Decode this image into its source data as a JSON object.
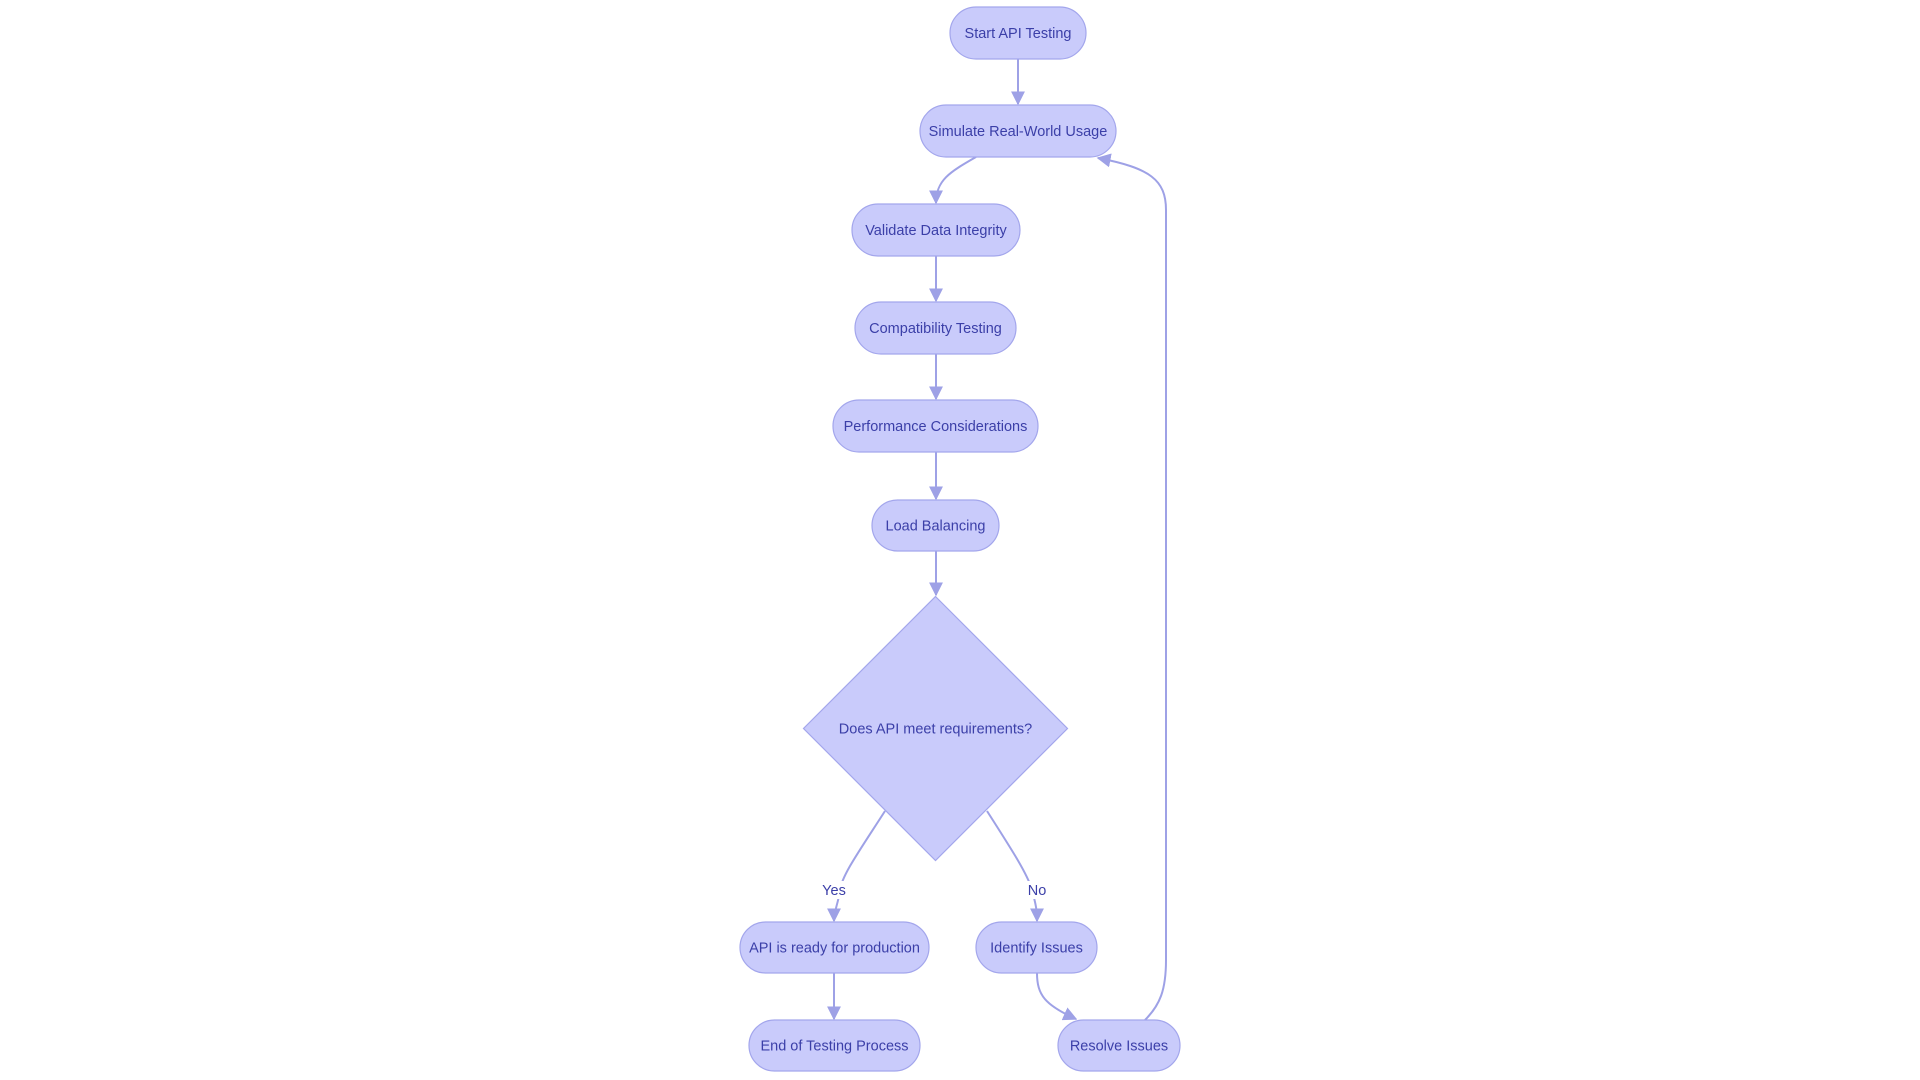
{
  "diagram": {
    "type": "flowchart",
    "colors": {
      "node_fill": "#c9cbfb",
      "node_stroke": "#a3a6ec",
      "edge": "#9ea1e6",
      "text": "#3b3fa8"
    },
    "nodes": [
      {
        "id": "start",
        "label": "Start API Testing",
        "shape": "stadium"
      },
      {
        "id": "simulate",
        "label": "Simulate Real-World Usage",
        "shape": "stadium"
      },
      {
        "id": "validate",
        "label": "Validate Data Integrity",
        "shape": "stadium"
      },
      {
        "id": "compat",
        "label": "Compatibility Testing",
        "shape": "stadium"
      },
      {
        "id": "perf",
        "label": "Performance Considerations",
        "shape": "stadium"
      },
      {
        "id": "load",
        "label": "Load Balancing",
        "shape": "stadium"
      },
      {
        "id": "decision",
        "label": "Does API meet requirements?",
        "shape": "diamond"
      },
      {
        "id": "ready",
        "label": "API is ready for production",
        "shape": "stadium"
      },
      {
        "id": "end",
        "label": "End of Testing Process",
        "shape": "stadium"
      },
      {
        "id": "identify",
        "label": "Identify Issues",
        "shape": "stadium"
      },
      {
        "id": "resolve",
        "label": "Resolve Issues",
        "shape": "stadium"
      }
    ],
    "edges": [
      {
        "from": "start",
        "to": "simulate",
        "label": ""
      },
      {
        "from": "simulate",
        "to": "validate",
        "label": ""
      },
      {
        "from": "validate",
        "to": "compat",
        "label": ""
      },
      {
        "from": "compat",
        "to": "perf",
        "label": ""
      },
      {
        "from": "perf",
        "to": "load",
        "label": ""
      },
      {
        "from": "load",
        "to": "decision",
        "label": ""
      },
      {
        "from": "decision",
        "to": "ready",
        "label": "Yes"
      },
      {
        "from": "decision",
        "to": "identify",
        "label": "No"
      },
      {
        "from": "ready",
        "to": "end",
        "label": ""
      },
      {
        "from": "identify",
        "to": "resolve",
        "label": ""
      },
      {
        "from": "resolve",
        "to": "simulate",
        "label": ""
      }
    ]
  }
}
